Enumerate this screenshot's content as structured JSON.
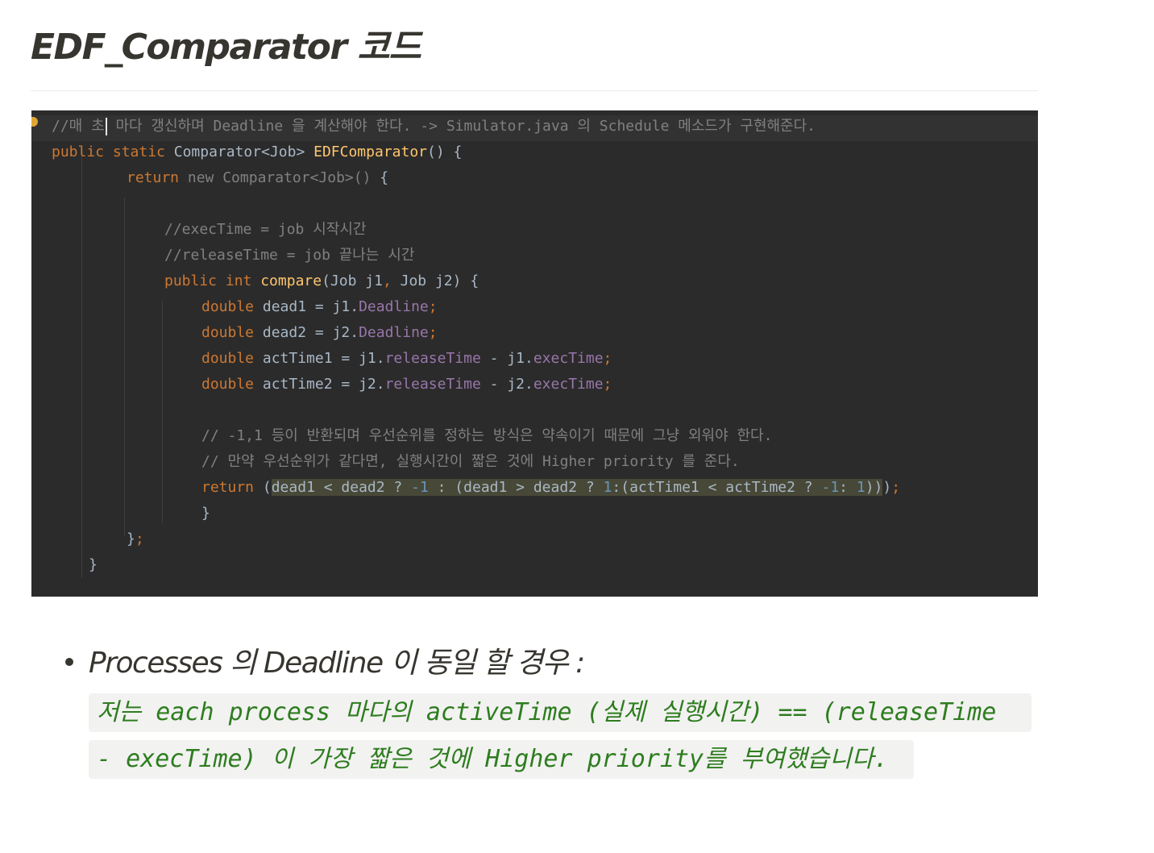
{
  "heading": "EDF_Comparator 코드",
  "code": {
    "line1": {
      "comment_before_caret": "//매 초",
      "comment_after_caret": " 마다 갱신하며 Deadline 을 계산해야 한다. -> Simulator.java 의 Schedule 메소드가 구현해준다."
    },
    "line2": {
      "kw": "public static",
      "type": " Comparator<Job> ",
      "fn": "EDFComparator",
      "tail": "() {"
    },
    "line3": {
      "kw": "return",
      "gray": " new Comparator<Job>() ",
      "tail": "{"
    },
    "line5": "//execTime = job 시작시간",
    "line6": "//releaseTime = job 끝나는 시간",
    "line7": {
      "kw": "public int",
      "fn": "compare",
      "params_a": "(Job j1",
      "comma": ",",
      "params_b": " Job j2) {"
    },
    "line8": {
      "kw": "double",
      "lhs": " dead1 = j1.",
      "fld": "Deadline",
      "semi": ";"
    },
    "line9": {
      "kw": "double",
      "lhs": " dead2 = j2.",
      "fld": "Deadline",
      "semi": ";"
    },
    "line10": {
      "kw": "double",
      "lhs": " actTime1 = j1.",
      "fld1": "releaseTime",
      "mid": " - j1.",
      "fld2": "execTime",
      "semi": ";"
    },
    "line11": {
      "kw": "double",
      "lhs": " actTime2 = j2.",
      "fld1": "releaseTime",
      "mid": " - j2.",
      "fld2": "execTime",
      "semi": ";"
    },
    "line13": "// -1,1 등이 반환되며 우선순위를 정하는 방식은 약속이기 때문에 그냥 외워야 한다.",
    "line14": "// 만약 우선순위가 같다면, 실행시간이 짧은 것에 Higher priority 를 준다.",
    "line15": {
      "kw": "return",
      "open": " (",
      "p1": "dead1 < dead2 ? ",
      "n1": "-1",
      "p2": " : (dead1 > dead2 ? ",
      "n2": "1",
      "p3": ":(actTime1 < actTime2 ? ",
      "n3": "-1",
      "p4": ": ",
      "n4": "1",
      "p5": "))",
      "close": ")",
      "semi": ";"
    },
    "line16": "}",
    "line17": {
      "brace": "}",
      "semi": ";"
    },
    "line18": "}"
  },
  "bullet": {
    "text": "Processes 의 Deadline 이 동일 할 경우 :",
    "note_line1": "저는 each process 마다의 activeTime (실제 실행시간) == (releaseTime",
    "note_line2": "- execTime) 이 가장 짧은 것에 Higher priority를 부여했습니다."
  }
}
